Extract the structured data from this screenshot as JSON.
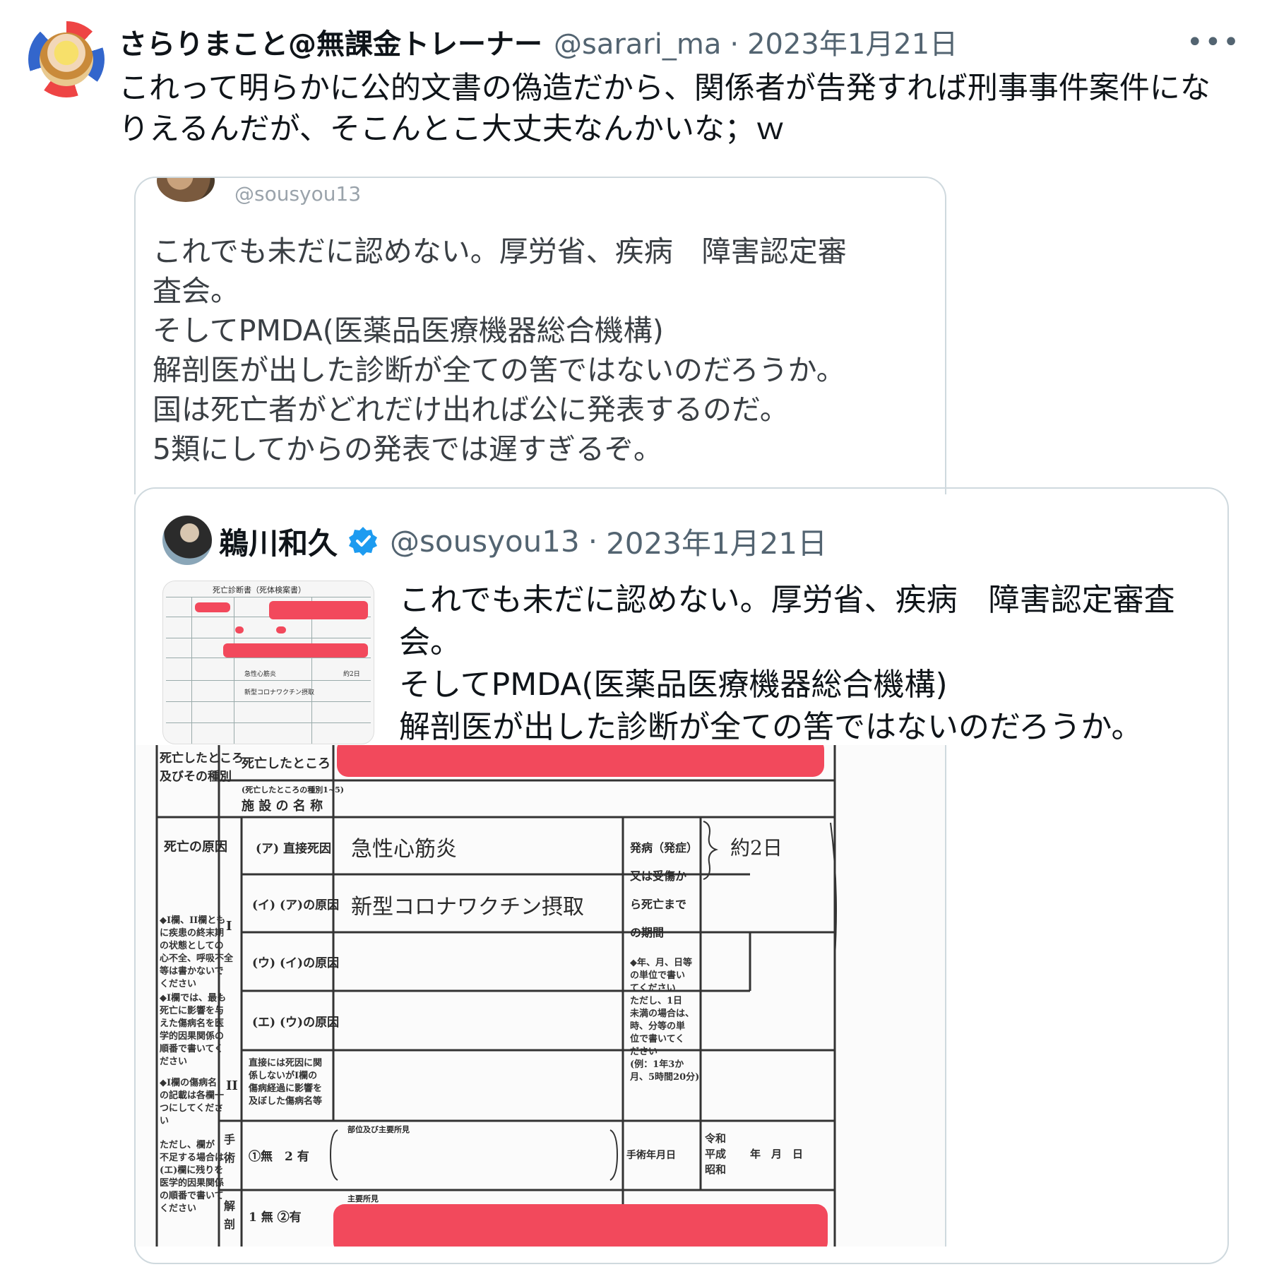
{
  "tweet": {
    "display_name": "さらりまこと@無課金トレーナー",
    "handle": "@sarari_ma",
    "separator": "·",
    "date": "2023年1月21日",
    "more": "•••",
    "body": "これって明らかに公的文書の偽造だから、関係者が告発すれば刑事事件案件になりえるんだが、そこんとこ大丈夫なんかいな；ｗ"
  },
  "quoted_screenshot": {
    "handle": "@sousyou13",
    "lines": [
      "これでも未だに認めない。厚労省、疾病　障害認定審",
      "査会。",
      "そしてPMDA(医薬品医療機器総合機構)",
      "解剖医が出した診断が全ての筈ではないのだろうか。",
      "国は死亡者がどれだけ出れば公に発表するのだ。",
      "5類にしてからの発表では遅すぎるぞ。"
    ]
  },
  "quoted_tweet": {
    "display_name": "鵜川和久",
    "handle": "@sousyou13",
    "separator": "·",
    "date": "2023年1月21日",
    "lines": [
      "これでも未だに認めない。厚労省、疾病　障害認定審査",
      "会。",
      "そしてPMDA(医薬品医療機器総合機構)",
      "解剖医が出した診断が全ての筈ではないのだろうか。"
    ]
  },
  "form": {
    "thumb_title": "死亡診断書（死体検案書）",
    "place_label_top": "死亡したところ",
    "place_label_top2": "及びその種別",
    "place_row_label": "死亡したところ",
    "facility_kind": "(死亡したところの種別1~5)",
    "facility_name": "施 設 の 名 称",
    "cause_header": "死亡の原因",
    "roman_1": "I",
    "roman_2": "II",
    "row_a": "(ア) 直接死因",
    "row_b": "(イ) (ア)の原因",
    "row_c": "(ウ) (イ)の原因",
    "row_d": "(エ) (ウ)の原因",
    "cause_a": "急性心筋炎",
    "cause_b": "新型コロナワクチン摂取",
    "onset_label_1": "発病（発症）",
    "onset_label_2": "又は受傷か",
    "onset_label_3": "ら死亡まで",
    "onset_label_4": "の期間",
    "onset_value": "約2日",
    "onset_note": "◆年、月、日等\nの単位で書い\nてください\nただし、1日\n未満の場合は、\n時、分等の単\n位で書いてく\nださい\n(例：1年3か\n月、5時間20分)",
    "left_note_1": "◆I欄、II欄とも\nに疾患の終末期\nの状態としての\n心不全、呼吸不全\n等は書かないで\nください",
    "left_note_2": "◆I欄では、最も\n死亡に影響を与\nえた傷病名を医\n学的因果関係の\n順番で書いてく\nださい",
    "left_note_3": "◆I欄の傷病名\nの記載は各欄一\nつにしてくださ\nい",
    "left_note_4": "ただし、欄が\n不足する場合は\n(エ)欄に残りを\n医学的因果関係\nの順番で書いて\nください",
    "ii_label": "直接には死因に関\n係しないがI欄の\n傷病経過に影響を\n及ぼした傷病名等",
    "surgery_label": "手\n術",
    "surgery_choice": "①無　2 有",
    "surgery_finding": "部位及び主要所見",
    "surgery_date_label": "手術年月日",
    "era_labels": "令和\n平成\n昭和",
    "ymd": "年　月　日",
    "autopsy_label": "解\n剖",
    "autopsy_choice": "1 無 ②有",
    "autopsy_finding": "主要所見"
  }
}
